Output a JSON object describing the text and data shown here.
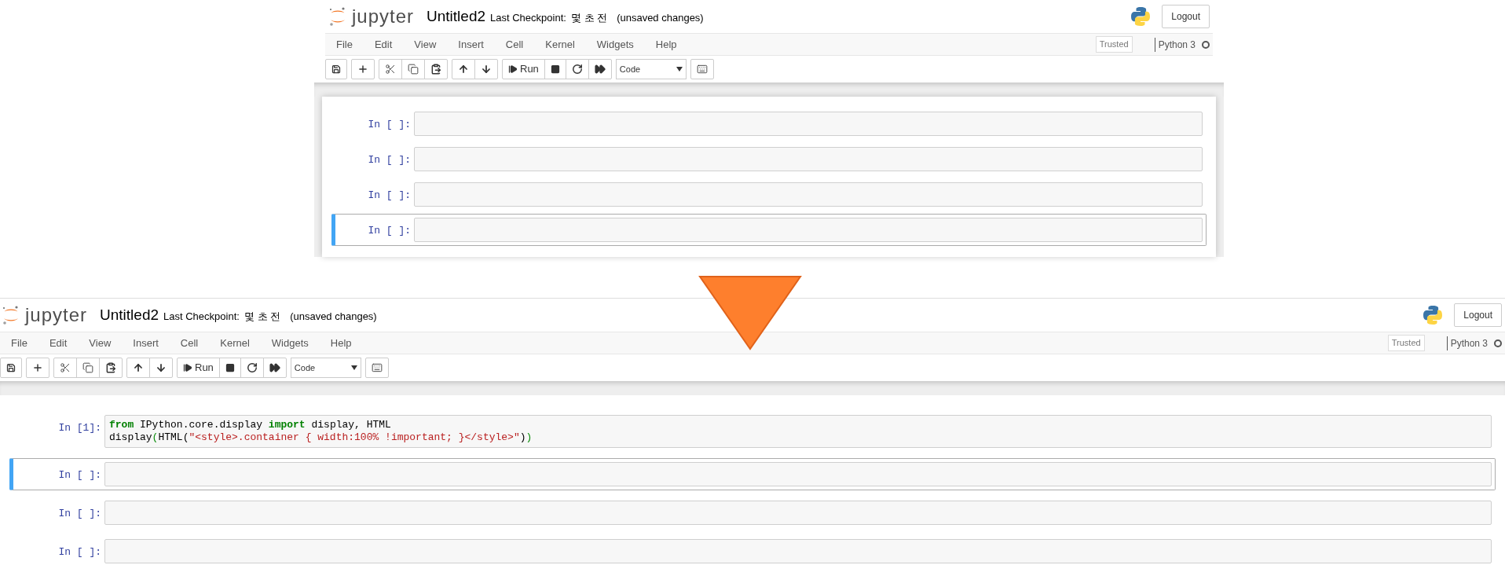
{
  "notebooks": [
    {
      "logo_text": "jupyter",
      "title": "Untitled2",
      "checkpoint_label": "Last Checkpoint:",
      "checkpoint_time": "몇 초 전",
      "save_status": "(unsaved changes)",
      "logout": "Logout",
      "menu": [
        "File",
        "Edit",
        "View",
        "Insert",
        "Cell",
        "Kernel",
        "Widgets",
        "Help"
      ],
      "trusted": "Trusted",
      "kernel_name": "Python 3",
      "kernel_busy": false,
      "run_label": "Run",
      "cell_type": "Code",
      "cells": [
        {
          "prompt": "In [ ]:",
          "selected": false
        },
        {
          "prompt": "In [ ]:",
          "selected": false
        },
        {
          "prompt": "In [ ]:",
          "selected": false
        },
        {
          "prompt": "In [ ]:",
          "selected": true
        }
      ]
    },
    {
      "logo_text": "jupyter",
      "title": "Untitled2",
      "checkpoint_label": "Last Checkpoint:",
      "checkpoint_time": "몇 초 전",
      "save_status": "(unsaved changes)",
      "logout": "Logout",
      "menu": [
        "File",
        "Edit",
        "View",
        "Insert",
        "Cell",
        "Kernel",
        "Widgets",
        "Help"
      ],
      "trusted": "Trusted",
      "kernel_name": "Python 3",
      "kernel_busy": false,
      "run_label": "Run",
      "cell_type": "Code",
      "cells": [
        {
          "prompt": "In [1]:",
          "selected": false,
          "code_lines": [
            [
              {
                "kind": "keyword",
                "text": "from"
              },
              {
                "kind": "plain",
                "text": " IPython.core.display "
              },
              {
                "kind": "keyword",
                "text": "import"
              },
              {
                "kind": "plain",
                "text": " display, HTML"
              }
            ],
            [
              {
                "kind": "plain",
                "text": "display"
              },
              {
                "kind": "bracket",
                "text": "("
              },
              {
                "kind": "plain",
                "text": "HTML("
              },
              {
                "kind": "string",
                "text": "\"<style>.container { width:100% !important; }</style>\""
              },
              {
                "kind": "plain",
                "text": ")"
              },
              {
                "kind": "bracket",
                "text": ")"
              }
            ]
          ]
        },
        {
          "prompt": "In [ ]:",
          "selected": true
        },
        {
          "prompt": "In [ ]:",
          "selected": false
        },
        {
          "prompt": "In [ ]:",
          "selected": false
        }
      ]
    }
  ]
}
